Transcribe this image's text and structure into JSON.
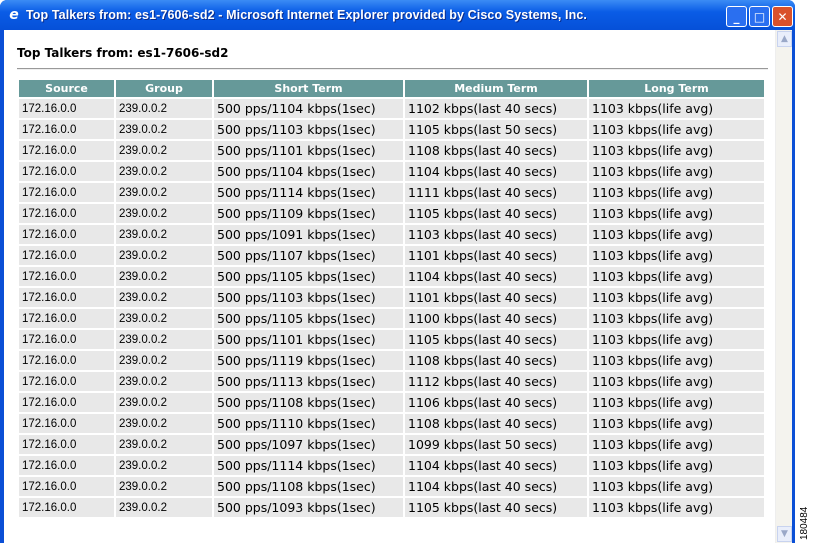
{
  "window": {
    "title": "Top Talkers from: es1-7606-sd2 - Microsoft Internet Explorer provided by Cisco Systems, Inc."
  },
  "page": {
    "heading": "Top Talkers from: es1-7606-sd2"
  },
  "table": {
    "headers": [
      "Source",
      "Group",
      "Short Term",
      "Medium Term",
      "Long Term"
    ],
    "rows": [
      [
        "172.16.0.0",
        "239.0.0.2",
        "500 pps/1104 kbps(1sec)",
        "1102 kbps(last 40 secs)",
        "1103 kbps(life avg)"
      ],
      [
        "172.16.0.0",
        "239.0.0.2",
        "500 pps/1103 kbps(1sec)",
        "1105 kbps(last 50 secs)",
        "1103 kbps(life avg)"
      ],
      [
        "172.16.0.0",
        "239.0.0.2",
        "500 pps/1101 kbps(1sec)",
        "1108 kbps(last 40 secs)",
        "1103 kbps(life avg)"
      ],
      [
        "172.16.0.0",
        "239.0.0.2",
        "500 pps/1104 kbps(1sec)",
        "1104 kbps(last 40 secs)",
        "1103 kbps(life avg)"
      ],
      [
        "172.16.0.0",
        "239.0.0.2",
        "500 pps/1114 kbps(1sec)",
        "1111 kbps(last 40 secs)",
        "1103 kbps(life avg)"
      ],
      [
        "172.16.0.0",
        "239.0.0.2",
        "500 pps/1109 kbps(1sec)",
        "1105 kbps(last 40 secs)",
        "1103 kbps(life avg)"
      ],
      [
        "172.16.0.0",
        "239.0.0.2",
        "500 pps/1091 kbps(1sec)",
        "1103 kbps(last 40 secs)",
        "1103 kbps(life avg)"
      ],
      [
        "172.16.0.0",
        "239.0.0.2",
        "500 pps/1107 kbps(1sec)",
        "1101 kbps(last 40 secs)",
        "1103 kbps(life avg)"
      ],
      [
        "172.16.0.0",
        "239.0.0.2",
        "500 pps/1105 kbps(1sec)",
        "1104 kbps(last 40 secs)",
        "1103 kbps(life avg)"
      ],
      [
        "172.16.0.0",
        "239.0.0.2",
        "500 pps/1103 kbps(1sec)",
        "1101 kbps(last 40 secs)",
        "1103 kbps(life avg)"
      ],
      [
        "172.16.0.0",
        "239.0.0.2",
        "500 pps/1105 kbps(1sec)",
        "1100 kbps(last 40 secs)",
        "1103 kbps(life avg)"
      ],
      [
        "172.16.0.0",
        "239.0.0.2",
        "500 pps/1101 kbps(1sec)",
        "1105 kbps(last 40 secs)",
        "1103 kbps(life avg)"
      ],
      [
        "172.16.0.0",
        "239.0.0.2",
        "500 pps/1119 kbps(1sec)",
        "1108 kbps(last 40 secs)",
        "1103 kbps(life avg)"
      ],
      [
        "172.16.0.0",
        "239.0.0.2",
        "500 pps/1113 kbps(1sec)",
        "1112 kbps(last 40 secs)",
        "1103 kbps(life avg)"
      ],
      [
        "172.16.0.0",
        "239.0.0.2",
        "500 pps/1108 kbps(1sec)",
        "1106 kbps(last 40 secs)",
        "1103 kbps(life avg)"
      ],
      [
        "172.16.0.0",
        "239.0.0.2",
        "500 pps/1110 kbps(1sec)",
        "1108 kbps(last 40 secs)",
        "1103 kbps(life avg)"
      ],
      [
        "172.16.0.0",
        "239.0.0.2",
        "500 pps/1097 kbps(1sec)",
        "1099 kbps(last 50 secs)",
        "1103 kbps(life avg)"
      ],
      [
        "172.16.0.0",
        "239.0.0.2",
        "500 pps/1114 kbps(1sec)",
        "1104 kbps(last 40 secs)",
        "1103 kbps(life avg)"
      ],
      [
        "172.16.0.0",
        "239.0.0.2",
        "500 pps/1108 kbps(1sec)",
        "1104 kbps(last 40 secs)",
        "1103 kbps(life avg)"
      ],
      [
        "172.16.0.0",
        "239.0.0.2",
        "500 pps/1093 kbps(1sec)",
        "1105 kbps(last 40 secs)",
        "1103 kbps(life avg)"
      ]
    ]
  },
  "figure_id": "180484"
}
